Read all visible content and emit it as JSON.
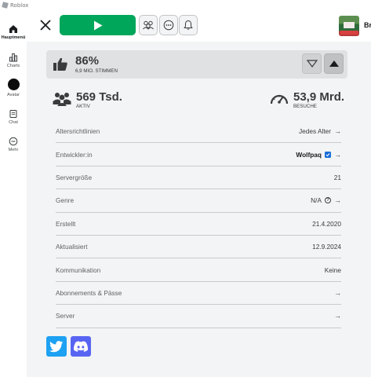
{
  "window": {
    "title": "Roblox"
  },
  "nav": {
    "items": [
      {
        "label": "Hauptmenü",
        "icon": "home-icon",
        "active": true
      },
      {
        "label": "Charts",
        "icon": "charts-icon",
        "active": false
      },
      {
        "label": "Avatar",
        "icon": "avatar-icon",
        "active": false
      },
      {
        "label": "Chat",
        "icon": "chat-icon",
        "active": false
      },
      {
        "label": "Mehr",
        "icon": "more-icon",
        "active": false
      }
    ]
  },
  "header": {
    "play_icon": "play-icon",
    "buttons": [
      "party-icon",
      "more-options-icon",
      "bell-icon"
    ],
    "cut_text": "Br"
  },
  "votes": {
    "percent": "86%",
    "count_label": "6,9 MIO. STIMMEN"
  },
  "stats": {
    "active_value": "569 Tsd.",
    "active_label": "AKTIV",
    "visits_value": "53,9 Mrd.",
    "visits_label": "BESUCHE"
  },
  "details": [
    {
      "key": "Altersrichtlinien",
      "value": "Jedes Alter",
      "arrow": "→"
    },
    {
      "key": "Entwickler:in",
      "value": "Wolfpaq",
      "arrow": "→",
      "verified": true
    },
    {
      "key": "Servergröße",
      "value": "21",
      "arrow": ""
    },
    {
      "key": "Genre",
      "value": "N/A",
      "arrow": "→",
      "help": "?"
    },
    {
      "key": "Erstellt",
      "value": "21.4.2020",
      "arrow": ""
    },
    {
      "key": "Aktualisiert",
      "value": "12.9.2024",
      "arrow": ""
    },
    {
      "key": "Kommunikation",
      "value": "Keine",
      "arrow": ""
    },
    {
      "key": "Abonnements & Pässe",
      "value": "",
      "arrow": "→"
    },
    {
      "key": "Server",
      "value": "",
      "arrow": "→"
    }
  ],
  "social": [
    "twitter-icon",
    "discord-icon"
  ],
  "colors": {
    "play": "#00a65a",
    "twitter": "#1da1f2",
    "discord": "#5865f2",
    "verified": "#1b6ed6",
    "main_bg": "#f2f4f5"
  }
}
